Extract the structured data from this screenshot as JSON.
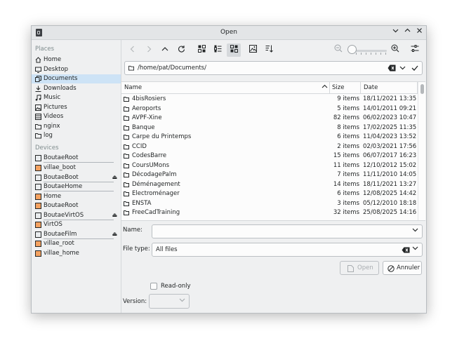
{
  "window": {
    "title": "Open"
  },
  "places_header": "Places",
  "places": [
    {
      "label": "Home",
      "icon": "home-icon"
    },
    {
      "label": "Desktop",
      "icon": "desktop-icon"
    },
    {
      "label": "Documents",
      "icon": "documents-icon",
      "selected": true
    },
    {
      "label": "Downloads",
      "icon": "download-icon"
    },
    {
      "label": "Music",
      "icon": "music-icon"
    },
    {
      "label": "Pictures",
      "icon": "pictures-icon"
    },
    {
      "label": "Videos",
      "icon": "videos-icon"
    },
    {
      "label": "nginx",
      "icon": "folder-icon"
    },
    {
      "label": "log",
      "icon": "folder-icon"
    }
  ],
  "devices_header": "Devices",
  "devices": [
    {
      "label": "BoutaeRoot",
      "icon": "drive-icon"
    },
    {
      "label": "villae_boot",
      "icon": "drive-icon"
    },
    {
      "label": "BoutaeBoot",
      "icon": "drive-icon",
      "eject": true
    },
    {
      "label": "BoutaeHome",
      "icon": "drive-icon"
    },
    {
      "label": "Home",
      "icon": "drive-icon"
    },
    {
      "label": "BoutaeRoot",
      "icon": "drive-icon"
    },
    {
      "label": "BoutaeVirtOS",
      "icon": "drive-icon",
      "eject": true
    },
    {
      "label": "VirtOS",
      "icon": "drive-icon"
    },
    {
      "label": "BoutaeFilm",
      "icon": "drive-icon",
      "eject": true
    },
    {
      "label": "villae_root",
      "icon": "drive-icon"
    },
    {
      "label": "villae_home",
      "icon": "drive-icon"
    }
  ],
  "location": {
    "path": "/home/pat/Documents/"
  },
  "columns": {
    "name": "Name",
    "size": "Size",
    "date": "Date"
  },
  "files": [
    {
      "name": "4bisRosiers",
      "size": "9 items",
      "date": "18/11/2021 13:35"
    },
    {
      "name": "Aeroports",
      "size": "5 items",
      "date": "14/01/2011 09:21"
    },
    {
      "name": "AVPF-Xine",
      "size": "82 items",
      "date": "06/02/2023 10:47"
    },
    {
      "name": "Banque",
      "size": "8 items",
      "date": "17/02/2025 11:35"
    },
    {
      "name": "Carpe du Printemps",
      "size": "6 items",
      "date": "11/04/2023 13:52"
    },
    {
      "name": "CCID",
      "size": "2 items",
      "date": "02/03/2021 17:56"
    },
    {
      "name": "CodesBarre",
      "size": "15 items",
      "date": "06/07/2017 16:23"
    },
    {
      "name": "CoursUMons",
      "size": "11 items",
      "date": "12/10/2012 15:02"
    },
    {
      "name": "DécodagePalm",
      "size": "7 items",
      "date": "11/11/2010 14:05"
    },
    {
      "name": "Déménagement",
      "size": "14 items",
      "date": "18/11/2021 13:27"
    },
    {
      "name": "Electroménager",
      "size": "6 items",
      "date": "12/08/2025 14:42"
    },
    {
      "name": "ENSTA",
      "size": "3 items",
      "date": "05/12/2010 18:18"
    },
    {
      "name": "FreeCadTraining",
      "size": "32 items",
      "date": "25/08/2025 14:16"
    }
  ],
  "form": {
    "name_label": "Name:",
    "name_value": "",
    "filetype_label": "File type:",
    "filetype_value": "All files",
    "open_label": "Open",
    "cancel_label": "Annuler",
    "readonly_label": "Read-only",
    "version_label": "Version:",
    "version_value": ""
  }
}
